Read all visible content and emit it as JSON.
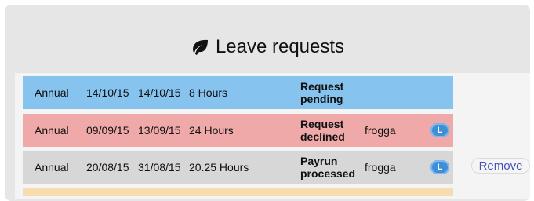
{
  "header": {
    "icon": "leaf-icon",
    "title": "Leave requests"
  },
  "actions": {
    "remove_label": "Remove"
  },
  "requests": [
    {
      "type": "Annual",
      "start": "14/10/15",
      "end": "14/10/15",
      "duration": "8 Hours",
      "status_line1": "Request",
      "status_line2": "pending",
      "user": "",
      "badge": "",
      "color": "#86c3ee"
    },
    {
      "type": "Annual",
      "start": "09/09/15",
      "end": "13/09/15",
      "duration": "24 Hours",
      "status_line1": "Request",
      "status_line2": "declined",
      "user": "frogga",
      "badge": "L",
      "color": "#efa9a9"
    },
    {
      "type": "Annual",
      "start": "20/08/15",
      "end": "31/08/15",
      "duration": "20.25 Hours",
      "status_line1": "Payrun",
      "status_line2": "processed",
      "user": "frogga",
      "badge": "L",
      "color": "#d7d7d7"
    }
  ],
  "colors": {
    "panel_bg": "#e6e6e6",
    "pending": "#86c3ee",
    "declined": "#efa9a9",
    "processed": "#d7d7d7",
    "partial_row": "#f6ddb0",
    "badge": "#3f8fd8",
    "link": "#4450b8"
  }
}
